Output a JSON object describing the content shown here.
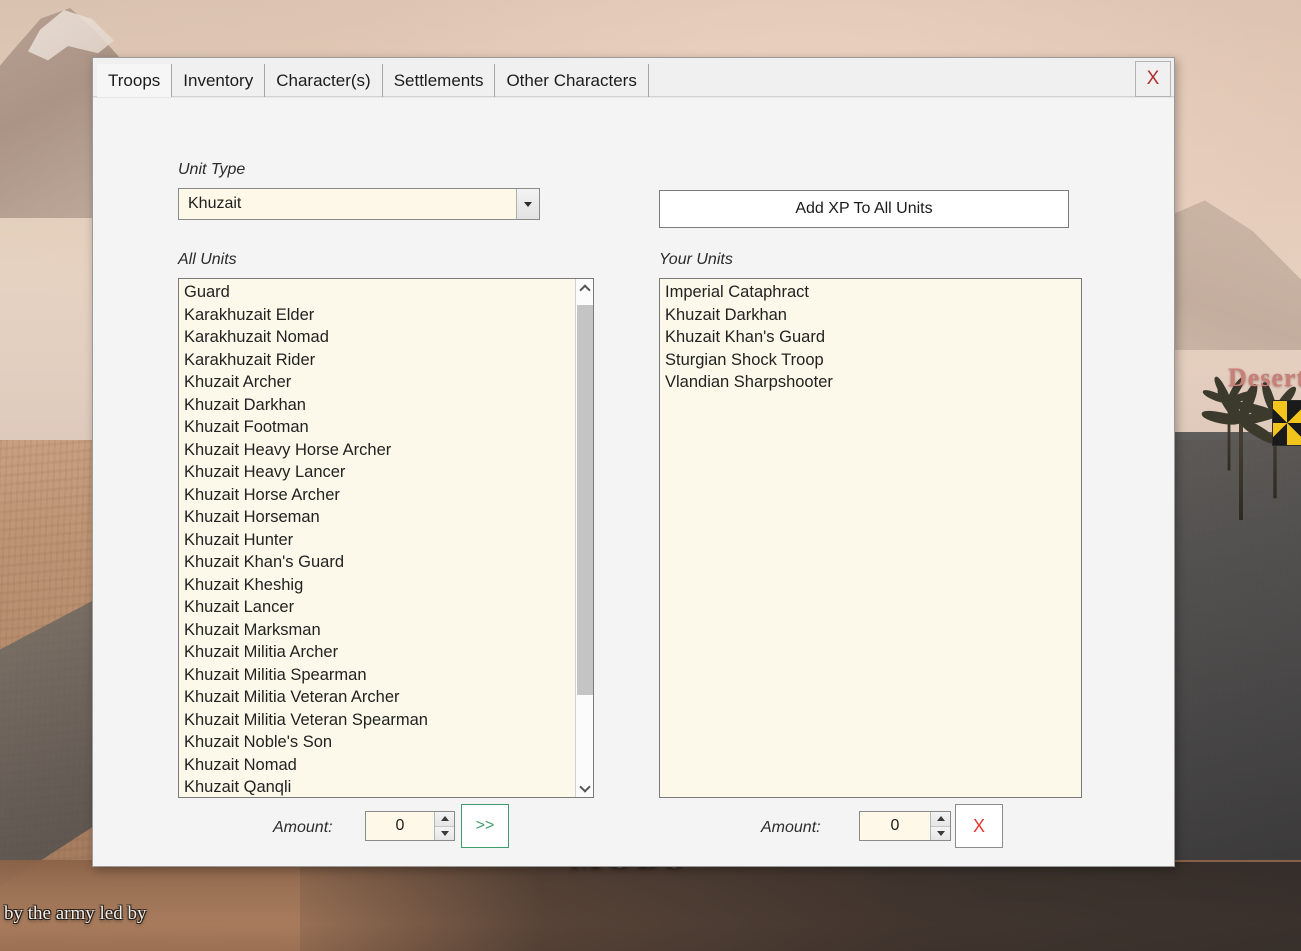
{
  "background": {
    "desert_label": "Desert",
    "army_caption": "by the army led by",
    "mods_caption": "MODS"
  },
  "window": {
    "close_label": "X",
    "tabs": [
      {
        "label": "Troops",
        "active": true
      },
      {
        "label": "Inventory",
        "active": false
      },
      {
        "label": "Character(s)",
        "active": false
      },
      {
        "label": "Settlements",
        "active": false
      },
      {
        "label": "Other Characters",
        "active": false
      }
    ]
  },
  "form": {
    "unit_type_label": "Unit Type",
    "unit_type_value": "Khuzait",
    "add_xp_label": "Add XP To All Units"
  },
  "all_units": {
    "label": "All Units",
    "items": [
      "Guard",
      "Karakhuzait Elder",
      "Karakhuzait Nomad",
      "Karakhuzait Rider",
      "Khuzait Archer",
      "Khuzait Darkhan",
      "Khuzait Footman",
      "Khuzait Heavy Horse Archer",
      "Khuzait Heavy Lancer",
      "Khuzait Horse Archer",
      "Khuzait Horseman",
      "Khuzait Hunter",
      "Khuzait Khan's Guard",
      "Khuzait Kheshig",
      "Khuzait Lancer",
      "Khuzait Marksman",
      "Khuzait Militia Archer",
      "Khuzait Militia Spearman",
      "Khuzait Militia Veteran Archer",
      "Khuzait Militia Veteran Spearman",
      "Khuzait Noble's Son",
      "Khuzait Nomad",
      "Khuzait Qanqli"
    ]
  },
  "your_units": {
    "label": "Your Units",
    "items": [
      "Imperial Cataphract",
      "Khuzait Darkhan",
      "Khuzait Khan's Guard",
      "Sturgian Shock Troop",
      "Vlandian Sharpshooter"
    ]
  },
  "left_controls": {
    "amount_label": "Amount:",
    "amount_value": "0",
    "action_label": ">>"
  },
  "right_controls": {
    "amount_label": "Amount:",
    "amount_value": "0",
    "action_label": "X"
  },
  "colors": {
    "accent_green": "#3f9c6d",
    "accent_red": "#e03b33",
    "field_bg": "#fdf8e7",
    "window_bg": "#f4f4f4"
  }
}
